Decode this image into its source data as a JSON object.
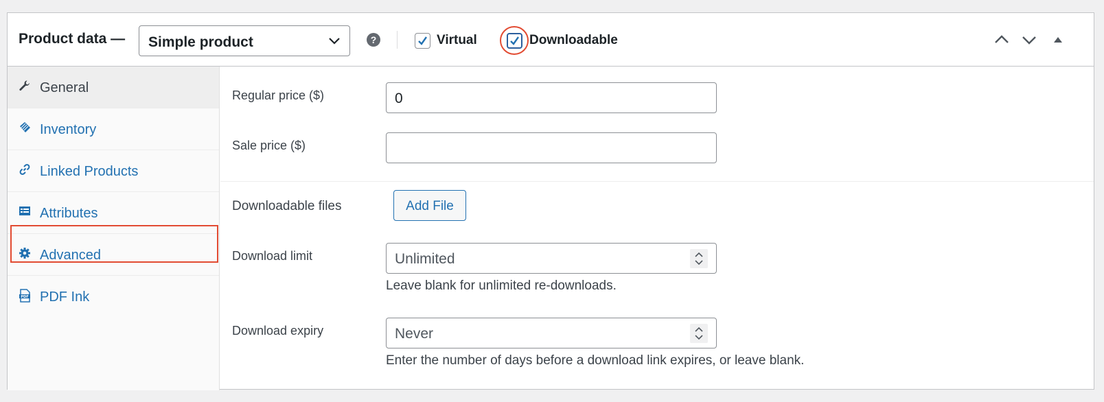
{
  "header": {
    "title": "Product data —",
    "product_type": "Simple product",
    "help": "?",
    "virtual_label": "Virtual",
    "virtual_checked": true,
    "downloadable_label": "Downloadable",
    "downloadable_checked": true
  },
  "sidebar": {
    "items": [
      {
        "label": "General",
        "icon": "wrench-icon",
        "active": true
      },
      {
        "label": "Inventory",
        "icon": "tag-icon",
        "active": false
      },
      {
        "label": "Linked Products",
        "icon": "link-icon",
        "active": false
      },
      {
        "label": "Attributes",
        "icon": "list-icon",
        "active": false
      },
      {
        "label": "Advanced",
        "icon": "gear-icon",
        "active": false
      },
      {
        "label": "PDF Ink",
        "icon": "pdf-icon",
        "active": false
      }
    ]
  },
  "general": {
    "regular_price_label": "Regular price ($)",
    "regular_price_value": "0",
    "sale_price_label": "Sale price ($)",
    "sale_price_value": "",
    "downloadable_files_label": "Downloadable files",
    "add_file_label": "Add File",
    "download_limit_label": "Download limit",
    "download_limit_placeholder": "Unlimited",
    "download_limit_help": "Leave blank for unlimited re-downloads.",
    "download_expiry_label": "Download expiry",
    "download_expiry_placeholder": "Never",
    "download_expiry_help": "Enter the number of days before a download link expires, or leave blank."
  },
  "colors": {
    "link": "#2271b1",
    "highlight": "#e24b32",
    "border": "#c3c4c7"
  }
}
